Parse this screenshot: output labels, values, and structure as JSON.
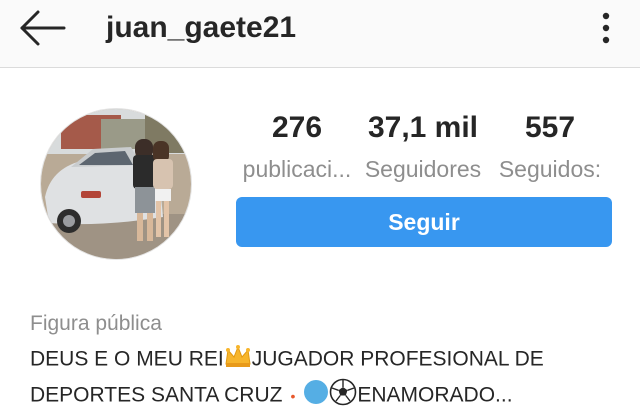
{
  "header": {
    "username": "juan_gaete21",
    "icons": {
      "back": "arrow-left-icon",
      "more": "more-vertical-icon"
    }
  },
  "profile": {
    "avatar": "profile-photo",
    "stats": [
      {
        "value": "276",
        "label": "publicaci..."
      },
      {
        "value": "37,1 mil",
        "label": "Seguidores"
      },
      {
        "value": "557",
        "label": "Seguidos:"
      }
    ],
    "follow_label": "Seguir",
    "category": "Figura pública",
    "bio": {
      "line1_a": "DEUS E O MEU REI",
      "line1_emoji": "crown-emoji",
      "line1_b": "JUGADOR PROFESIONAL DE",
      "line2_a": "DEPORTES SANTA CRUZ",
      "line2_dot": "•",
      "line2_emojis": [
        "blue-circle-emoji",
        "soccer-ball-emoji"
      ],
      "line2_b": "ENAMORADO..."
    }
  },
  "colors": {
    "accent": "#3897f0",
    "text": "#262626",
    "muted": "#8e8e8e",
    "topbar_bg": "#fafafa",
    "divider": "#dbdbdb"
  }
}
